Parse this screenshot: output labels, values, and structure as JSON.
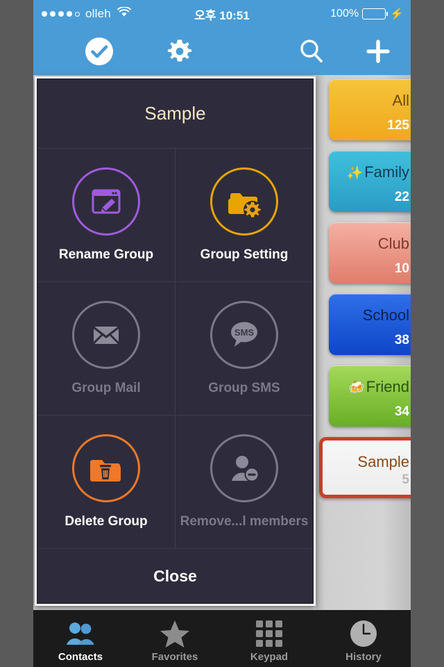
{
  "status_bar": {
    "carrier": "olleh",
    "time": "오후 10:51",
    "battery_percent": "100%",
    "signal_dots_filled": 4,
    "signal_dots_total": 5,
    "wifi_icon": "wifi-icon",
    "charging_icon": "lightning-bolt-icon"
  },
  "nav_bar": {
    "background": "#4a9cd6",
    "buttons": [
      {
        "name": "select-all-button",
        "icon": "check-circle-icon"
      },
      {
        "name": "settings-button",
        "icon": "gear-icon"
      },
      {
        "name": "search-button",
        "icon": "search-icon"
      },
      {
        "name": "add-button",
        "icon": "plus-icon"
      }
    ]
  },
  "group_tabs": [
    {
      "label": "All",
      "count": "125",
      "emoji": "",
      "color": "#f0a81e",
      "color2": "#f5c43a",
      "text_color": "#6b4a12",
      "count_color": "#ffffff",
      "selected": false
    },
    {
      "label": "Family",
      "count": "22",
      "emoji": "✨",
      "color": "#2b9bc4",
      "color2": "#3fc0dd",
      "text_color": "#123c52",
      "count_color": "#ffffff",
      "selected": false
    },
    {
      "label": "Club",
      "count": "10",
      "emoji": "",
      "color": "#df7d6c",
      "color2": "#f5b0a2",
      "text_color": "#7a3a2e",
      "count_color": "#ffffff",
      "selected": false
    },
    {
      "label": "School",
      "count": "38",
      "emoji": "",
      "color": "#0d46c8",
      "color2": "#2f6fe8",
      "text_color": "#0a1f52",
      "count_color": "#ffffff",
      "selected": false
    },
    {
      "label": "Friend",
      "count": "34",
      "emoji": "🍻",
      "color": "#68ae25",
      "color2": "#a5d95a",
      "text_color": "#2e5310",
      "count_color": "#ffffff",
      "selected": false
    },
    {
      "label": "Sample",
      "count": "5",
      "emoji": "",
      "color": "#ededed",
      "color2": "#f7f7f7",
      "text_color": "#8a4a1a",
      "count_color": "#b8b8b8",
      "selected": true,
      "border_color": "#c9402a"
    }
  ],
  "dialog": {
    "title": "Sample",
    "close_label": "Close",
    "actions": [
      {
        "label": "Rename Group",
        "icon": "window-pencil-icon",
        "color": "#a05ae0",
        "enabled": true
      },
      {
        "label": "Group Setting",
        "icon": "folder-gear-icon",
        "color": "#e8a400",
        "enabled": true
      },
      {
        "label": "Group Mail",
        "icon": "envelope-icon",
        "color": "#8c8998",
        "enabled": false
      },
      {
        "label": "Group SMS",
        "icon": "sms-bubble-icon",
        "color": "#8c8998",
        "enabled": false
      },
      {
        "label": "Delete Group",
        "icon": "folder-trash-icon",
        "color": "#f07828",
        "enabled": true
      },
      {
        "label": "Remove...l members",
        "icon": "person-minus-icon",
        "color": "#8c8998",
        "enabled": false
      }
    ]
  },
  "tab_bar": {
    "items": [
      {
        "label": "Contacts",
        "icon": "people-icon",
        "active": true
      },
      {
        "label": "Favorites",
        "icon": "star-icon",
        "active": false
      },
      {
        "label": "Keypad",
        "icon": "grid-icon",
        "active": false
      },
      {
        "label": "History",
        "icon": "clock-icon",
        "active": false
      }
    ]
  }
}
